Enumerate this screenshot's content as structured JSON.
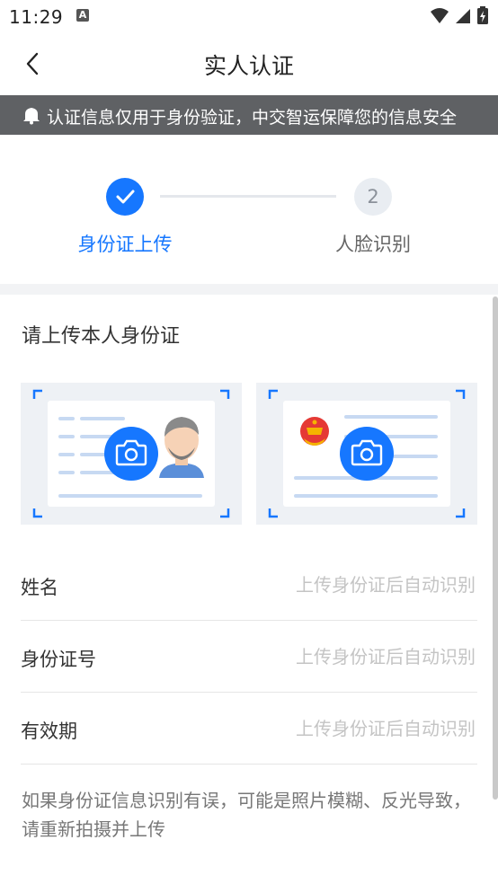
{
  "status_bar": {
    "time": "11:29",
    "notification_letter": "A"
  },
  "header": {
    "title": "实人认证"
  },
  "notice": {
    "text": "认证信息仅用于身份验证，中交智运保障您的信息安全"
  },
  "steps": [
    {
      "label": "身份证上传",
      "state": "done"
    },
    {
      "number": "2",
      "label": "人脸识别",
      "state": "pending"
    }
  ],
  "upload": {
    "title": "请上传本人身份证",
    "front_card_icon": "camera-icon",
    "back_card_icon": "camera-icon"
  },
  "form": {
    "name": {
      "label": "姓名",
      "placeholder": "上传身份证后自动识别"
    },
    "id_number": {
      "label": "身份证号",
      "placeholder": "上传身份证后自动识别"
    },
    "validity": {
      "label": "有效期",
      "placeholder": "上传身份证后自动识别"
    }
  },
  "tip": {
    "text": "如果身份证信息识别有误，可能是照片模糊、反光导致，请重新拍摄并上传"
  },
  "colors": {
    "accent": "#1677ff",
    "notice_bg": "#5f6164",
    "card_bg": "#eef1f5"
  }
}
